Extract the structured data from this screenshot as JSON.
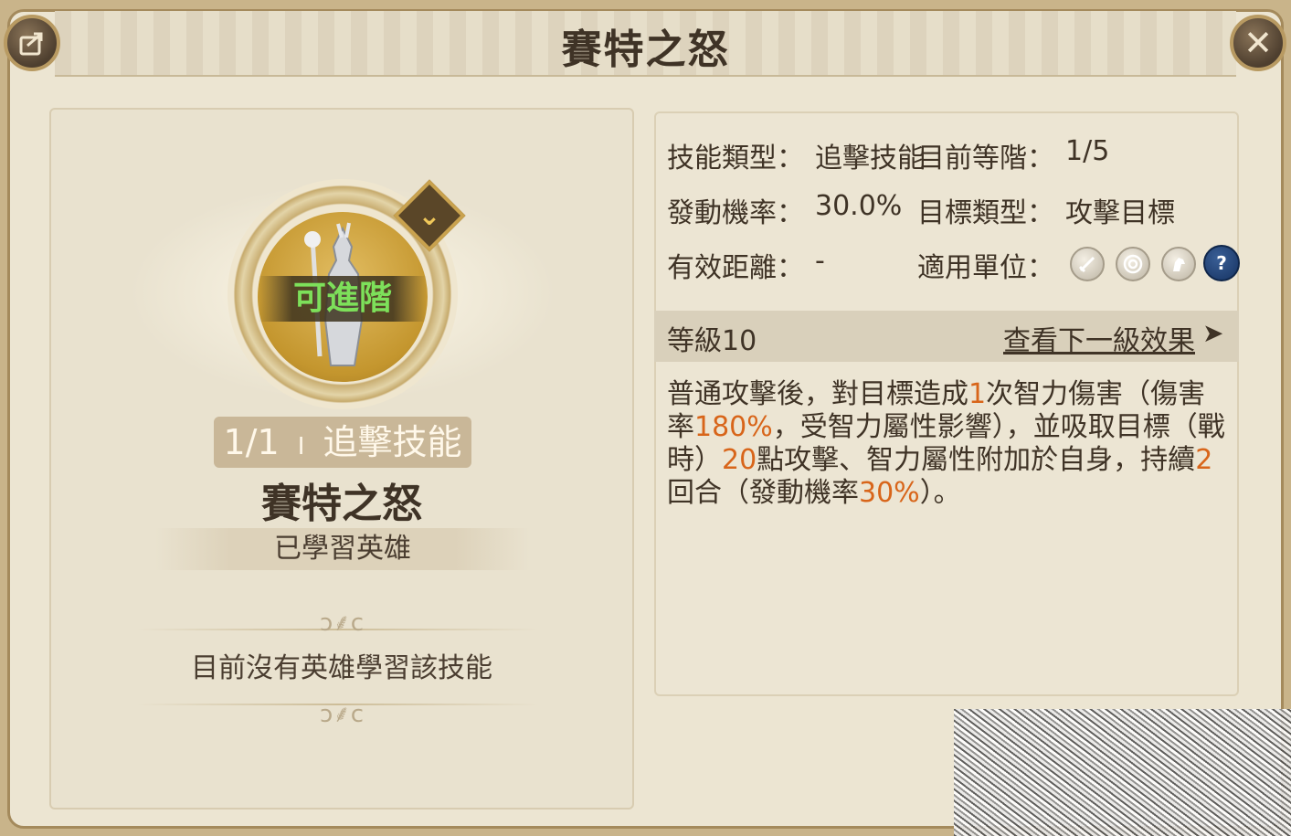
{
  "header": {
    "title": "賽特之怒"
  },
  "skill_card": {
    "upgrade_badge": "可進階",
    "rank": "1/1",
    "separator": "I",
    "type": "追擊技能",
    "name": "賽特之怒",
    "learned_label": "已學習英雄",
    "no_hero_text": "目前沒有英雄學習該技能"
  },
  "info": {
    "skill_type_label": "技能類型：",
    "skill_type_value": "追擊技能",
    "current_rank_label": "目前等階：",
    "current_rank_value": "1/5",
    "trigger_rate_label": "發動機率：",
    "trigger_rate_value": "30.0%",
    "target_type_label": "目標類型：",
    "target_type_value": "攻擊目標",
    "range_label": "有效距離：",
    "range_value": "-",
    "units_label": "適用單位：",
    "unit_icons": [
      "sword-icon",
      "target-icon",
      "horse-icon",
      "question-icon"
    ],
    "help_glyph": "?"
  },
  "level": {
    "label": "等級10",
    "next_link": "查看下一級效果",
    "next_arrow": "➤"
  },
  "description": {
    "p1": "普通攻擊後，對目標造成",
    "n1": "1",
    "p2": "次智力傷害（傷害率",
    "n2": "180%",
    "p3": "，受智力屬性影響），並吸取目標（戰時）",
    "n3": "20",
    "p4": "點攻擊、智力屬性附加於自身，持續",
    "n4": "2",
    "p5": "回合（發動機率",
    "n5": "30%",
    "p6": "）。"
  },
  "colors": {
    "highlight": "#d8651a",
    "upgrade_text": "#7de05a",
    "panel_bg": "#ece5d2"
  }
}
